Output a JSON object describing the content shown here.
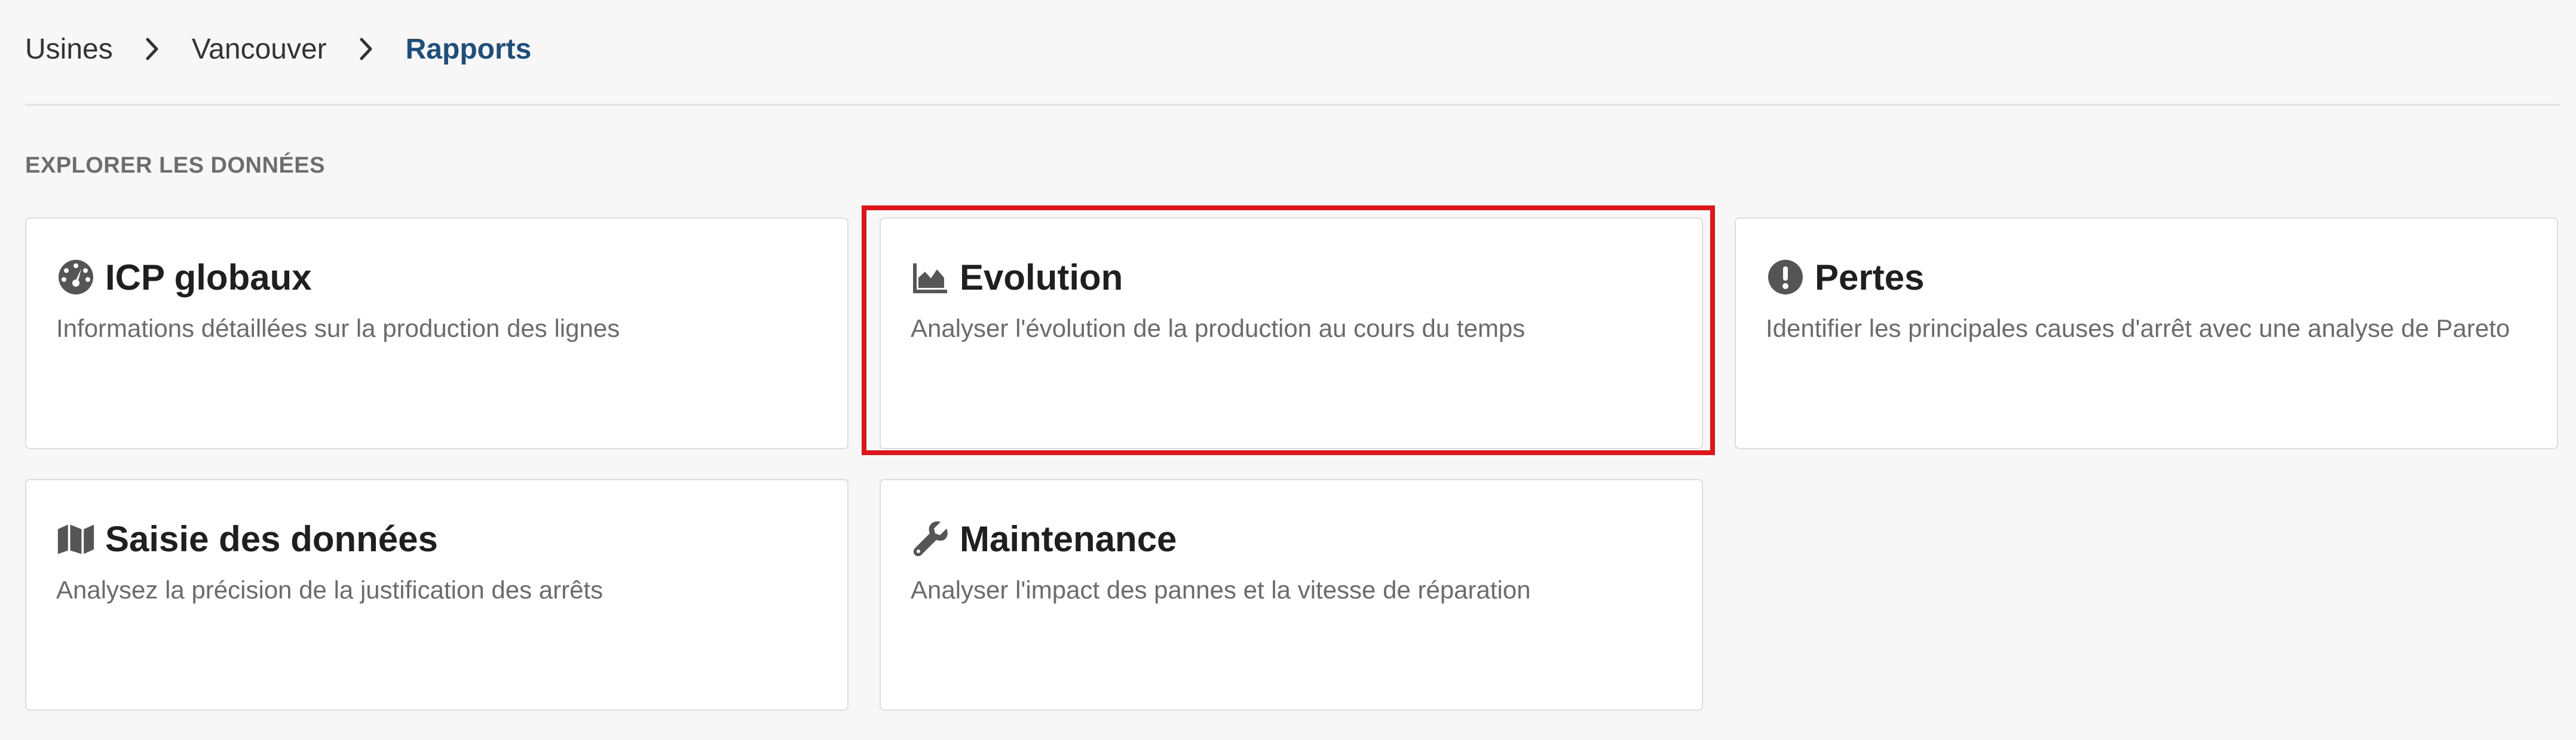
{
  "breadcrumb": {
    "items": [
      "Usines",
      "Vancouver",
      "Rapports"
    ]
  },
  "section": {
    "title": "EXPLORER LES DONNÉES"
  },
  "cards": [
    {
      "icon": "gauge-icon",
      "title": "ICP globaux",
      "description": "Informations détaillées sur la production des lignes"
    },
    {
      "icon": "area-chart-icon",
      "title": "Evolution",
      "description": "Analyser l'évolution de la production au cours du temps",
      "highlighted": true
    },
    {
      "icon": "exclamation-circle-icon",
      "title": "Pertes",
      "description": "Identifier les principales causes d'arrêt avec une analyse de Pareto"
    },
    {
      "icon": "map-icon",
      "title": "Saisie des données",
      "description": "Analysez la précision de la justification des arrêts"
    },
    {
      "icon": "wrench-icon",
      "title": "Maintenance",
      "description": "Analyser l'impact des pannes et la vitesse de réparation"
    }
  ],
  "colors": {
    "background": "#f7f7f7",
    "breadcrumb_current": "#1e4f7c",
    "highlight": "#e0141b",
    "icon": "#555555"
  }
}
